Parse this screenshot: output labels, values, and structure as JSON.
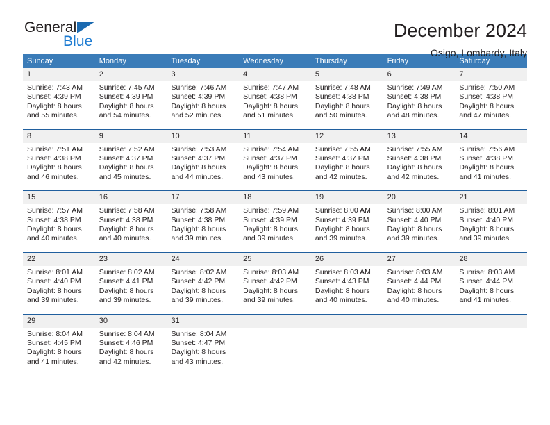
{
  "logo": {
    "word_one": "General",
    "word_two": "Blue",
    "triangle": "blue-triangle-icon",
    "accent_dark": "#1b6ab0",
    "accent_light": "#1b7ad1"
  },
  "header": {
    "title": "December 2024",
    "subtitle": "Osigo, Lombardy, Italy"
  },
  "theme": {
    "header_blue": "#3b7cb8",
    "divider_blue": "#205f9e",
    "daynum_bg": "#f0f0f0",
    "text": "#231f20"
  },
  "calendar": {
    "weekdays": [
      "Sunday",
      "Monday",
      "Tuesday",
      "Wednesday",
      "Thursday",
      "Friday",
      "Saturday"
    ],
    "weeks": [
      {
        "days": [
          {
            "num": "1",
            "sunrise": "Sunrise: 7:43 AM",
            "sunset": "Sunset: 4:39 PM",
            "daylight1": "Daylight: 8 hours",
            "daylight2": "and 55 minutes."
          },
          {
            "num": "2",
            "sunrise": "Sunrise: 7:45 AM",
            "sunset": "Sunset: 4:39 PM",
            "daylight1": "Daylight: 8 hours",
            "daylight2": "and 54 minutes."
          },
          {
            "num": "3",
            "sunrise": "Sunrise: 7:46 AM",
            "sunset": "Sunset: 4:39 PM",
            "daylight1": "Daylight: 8 hours",
            "daylight2": "and 52 minutes."
          },
          {
            "num": "4",
            "sunrise": "Sunrise: 7:47 AM",
            "sunset": "Sunset: 4:38 PM",
            "daylight1": "Daylight: 8 hours",
            "daylight2": "and 51 minutes."
          },
          {
            "num": "5",
            "sunrise": "Sunrise: 7:48 AM",
            "sunset": "Sunset: 4:38 PM",
            "daylight1": "Daylight: 8 hours",
            "daylight2": "and 50 minutes."
          },
          {
            "num": "6",
            "sunrise": "Sunrise: 7:49 AM",
            "sunset": "Sunset: 4:38 PM",
            "daylight1": "Daylight: 8 hours",
            "daylight2": "and 48 minutes."
          },
          {
            "num": "7",
            "sunrise": "Sunrise: 7:50 AM",
            "sunset": "Sunset: 4:38 PM",
            "daylight1": "Daylight: 8 hours",
            "daylight2": "and 47 minutes."
          }
        ]
      },
      {
        "days": [
          {
            "num": "8",
            "sunrise": "Sunrise: 7:51 AM",
            "sunset": "Sunset: 4:38 PM",
            "daylight1": "Daylight: 8 hours",
            "daylight2": "and 46 minutes."
          },
          {
            "num": "9",
            "sunrise": "Sunrise: 7:52 AM",
            "sunset": "Sunset: 4:37 PM",
            "daylight1": "Daylight: 8 hours",
            "daylight2": "and 45 minutes."
          },
          {
            "num": "10",
            "sunrise": "Sunrise: 7:53 AM",
            "sunset": "Sunset: 4:37 PM",
            "daylight1": "Daylight: 8 hours",
            "daylight2": "and 44 minutes."
          },
          {
            "num": "11",
            "sunrise": "Sunrise: 7:54 AM",
            "sunset": "Sunset: 4:37 PM",
            "daylight1": "Daylight: 8 hours",
            "daylight2": "and 43 minutes."
          },
          {
            "num": "12",
            "sunrise": "Sunrise: 7:55 AM",
            "sunset": "Sunset: 4:37 PM",
            "daylight1": "Daylight: 8 hours",
            "daylight2": "and 42 minutes."
          },
          {
            "num": "13",
            "sunrise": "Sunrise: 7:55 AM",
            "sunset": "Sunset: 4:38 PM",
            "daylight1": "Daylight: 8 hours",
            "daylight2": "and 42 minutes."
          },
          {
            "num": "14",
            "sunrise": "Sunrise: 7:56 AM",
            "sunset": "Sunset: 4:38 PM",
            "daylight1": "Daylight: 8 hours",
            "daylight2": "and 41 minutes."
          }
        ]
      },
      {
        "days": [
          {
            "num": "15",
            "sunrise": "Sunrise: 7:57 AM",
            "sunset": "Sunset: 4:38 PM",
            "daylight1": "Daylight: 8 hours",
            "daylight2": "and 40 minutes."
          },
          {
            "num": "16",
            "sunrise": "Sunrise: 7:58 AM",
            "sunset": "Sunset: 4:38 PM",
            "daylight1": "Daylight: 8 hours",
            "daylight2": "and 40 minutes."
          },
          {
            "num": "17",
            "sunrise": "Sunrise: 7:58 AM",
            "sunset": "Sunset: 4:38 PM",
            "daylight1": "Daylight: 8 hours",
            "daylight2": "and 39 minutes."
          },
          {
            "num": "18",
            "sunrise": "Sunrise: 7:59 AM",
            "sunset": "Sunset: 4:39 PM",
            "daylight1": "Daylight: 8 hours",
            "daylight2": "and 39 minutes."
          },
          {
            "num": "19",
            "sunrise": "Sunrise: 8:00 AM",
            "sunset": "Sunset: 4:39 PM",
            "daylight1": "Daylight: 8 hours",
            "daylight2": "and 39 minutes."
          },
          {
            "num": "20",
            "sunrise": "Sunrise: 8:00 AM",
            "sunset": "Sunset: 4:40 PM",
            "daylight1": "Daylight: 8 hours",
            "daylight2": "and 39 minutes."
          },
          {
            "num": "21",
            "sunrise": "Sunrise: 8:01 AM",
            "sunset": "Sunset: 4:40 PM",
            "daylight1": "Daylight: 8 hours",
            "daylight2": "and 39 minutes."
          }
        ]
      },
      {
        "days": [
          {
            "num": "22",
            "sunrise": "Sunrise: 8:01 AM",
            "sunset": "Sunset: 4:40 PM",
            "daylight1": "Daylight: 8 hours",
            "daylight2": "and 39 minutes."
          },
          {
            "num": "23",
            "sunrise": "Sunrise: 8:02 AM",
            "sunset": "Sunset: 4:41 PM",
            "daylight1": "Daylight: 8 hours",
            "daylight2": "and 39 minutes."
          },
          {
            "num": "24",
            "sunrise": "Sunrise: 8:02 AM",
            "sunset": "Sunset: 4:42 PM",
            "daylight1": "Daylight: 8 hours",
            "daylight2": "and 39 minutes."
          },
          {
            "num": "25",
            "sunrise": "Sunrise: 8:03 AM",
            "sunset": "Sunset: 4:42 PM",
            "daylight1": "Daylight: 8 hours",
            "daylight2": "and 39 minutes."
          },
          {
            "num": "26",
            "sunrise": "Sunrise: 8:03 AM",
            "sunset": "Sunset: 4:43 PM",
            "daylight1": "Daylight: 8 hours",
            "daylight2": "and 40 minutes."
          },
          {
            "num": "27",
            "sunrise": "Sunrise: 8:03 AM",
            "sunset": "Sunset: 4:44 PM",
            "daylight1": "Daylight: 8 hours",
            "daylight2": "and 40 minutes."
          },
          {
            "num": "28",
            "sunrise": "Sunrise: 8:03 AM",
            "sunset": "Sunset: 4:44 PM",
            "daylight1": "Daylight: 8 hours",
            "daylight2": "and 41 minutes."
          }
        ]
      },
      {
        "days": [
          {
            "num": "29",
            "sunrise": "Sunrise: 8:04 AM",
            "sunset": "Sunset: 4:45 PM",
            "daylight1": "Daylight: 8 hours",
            "daylight2": "and 41 minutes."
          },
          {
            "num": "30",
            "sunrise": "Sunrise: 8:04 AM",
            "sunset": "Sunset: 4:46 PM",
            "daylight1": "Daylight: 8 hours",
            "daylight2": "and 42 minutes."
          },
          {
            "num": "31",
            "sunrise": "Sunrise: 8:04 AM",
            "sunset": "Sunset: 4:47 PM",
            "daylight1": "Daylight: 8 hours",
            "daylight2": "and 43 minutes."
          },
          {
            "num": "",
            "sunrise": "",
            "sunset": "",
            "daylight1": "",
            "daylight2": ""
          },
          {
            "num": "",
            "sunrise": "",
            "sunset": "",
            "daylight1": "",
            "daylight2": ""
          },
          {
            "num": "",
            "sunrise": "",
            "sunset": "",
            "daylight1": "",
            "daylight2": ""
          },
          {
            "num": "",
            "sunrise": "",
            "sunset": "",
            "daylight1": "",
            "daylight2": ""
          }
        ]
      }
    ]
  }
}
